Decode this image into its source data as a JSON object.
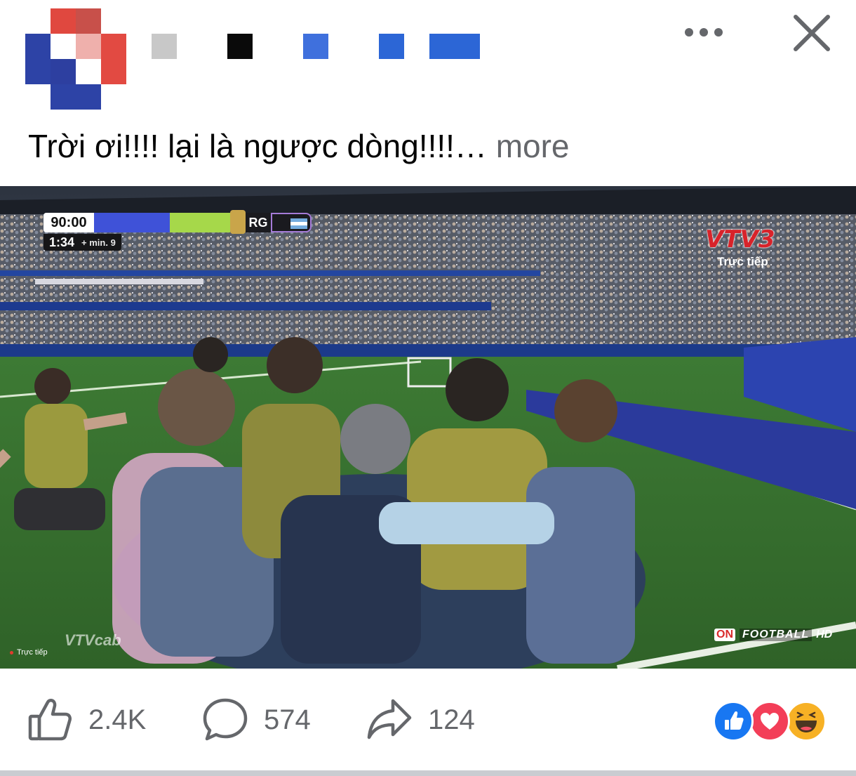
{
  "post": {
    "caption": "Trời ơi!!!! lại là ngược dòng!!!!…",
    "more_label": "more"
  },
  "author": {
    "avatar_icon": "pixelated-avatar-icon",
    "name_redaction_colors": [
      "#c8c8c8",
      "#0a0a0a",
      "#3f70dd",
      "#2c66d6",
      "#2c66d6"
    ]
  },
  "video": {
    "scoreboard": {
      "match_time": "90:00",
      "added_time": "1:34",
      "added_minutes": "+ min. 9",
      "team_code": "RG"
    },
    "channel_logo": "VTV3",
    "live_label": "Trực tiếp",
    "bottom_left_live": "Trực tiếp",
    "watermark": "VTVcab",
    "sponsor": {
      "on": "ON",
      "football": "FOOTBALL",
      "hd": "HD"
    }
  },
  "actions": {
    "like_count": "2.4K",
    "comment_count": "574",
    "share_count": "124"
  },
  "reactions": [
    "like-reaction-icon",
    "love-reaction-icon",
    "haha-reaction-icon"
  ],
  "colors": {
    "like_blue": "#1877f2",
    "love_red": "#f33e58",
    "haha_yellow": "#f7b125",
    "secondary_text": "#65676b"
  }
}
